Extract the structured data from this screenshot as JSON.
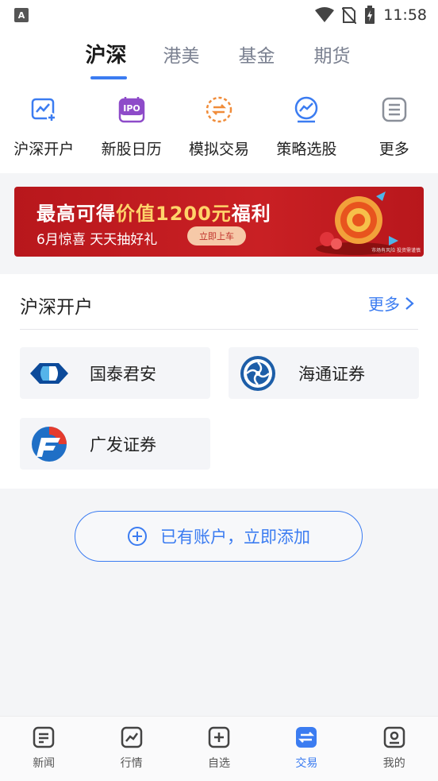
{
  "status_bar": {
    "time": "11:58",
    "left_icon_text": "A"
  },
  "top_tabs": [
    {
      "label": "沪深",
      "active": true
    },
    {
      "label": "港美",
      "active": false
    },
    {
      "label": "基金",
      "active": false
    },
    {
      "label": "期货",
      "active": false
    }
  ],
  "quick_actions": [
    {
      "label": "沪深开户",
      "icon": "chart-plus-icon"
    },
    {
      "label": "新股日历",
      "icon": "ipo-calendar-icon"
    },
    {
      "label": "模拟交易",
      "icon": "exchange-arrows-icon"
    },
    {
      "label": "策略选股",
      "icon": "strategy-chart-icon"
    },
    {
      "label": "更多",
      "icon": "menu-list-icon"
    }
  ],
  "banner": {
    "title_prefix": "最高可得",
    "title_highlight": "价值1200元",
    "title_suffix": "福利",
    "subtitle": "6月惊喜 天天抽好礼",
    "button": "立即上车",
    "disclaimer": "市场有风险 投资需谨慎"
  },
  "account_section": {
    "title": "沪深开户",
    "more": "更多",
    "brokers": [
      {
        "name": "国泰君安",
        "logo": "guotai-junan-logo"
      },
      {
        "name": "海通证券",
        "logo": "haitong-logo"
      },
      {
        "name": "广发证券",
        "logo": "guangfa-logo"
      }
    ]
  },
  "add_account_button": "已有账户，立即添加",
  "bottom_nav": [
    {
      "label": "新闻",
      "active": false
    },
    {
      "label": "行情",
      "active": false
    },
    {
      "label": "自选",
      "active": false
    },
    {
      "label": "交易",
      "active": true
    },
    {
      "label": "我的",
      "active": false
    }
  ],
  "colors": {
    "accent": "#3b7cf1",
    "banner_red": "#c92024",
    "ipo_purple": "#8e4bc9",
    "orange": "#f08c3a"
  }
}
